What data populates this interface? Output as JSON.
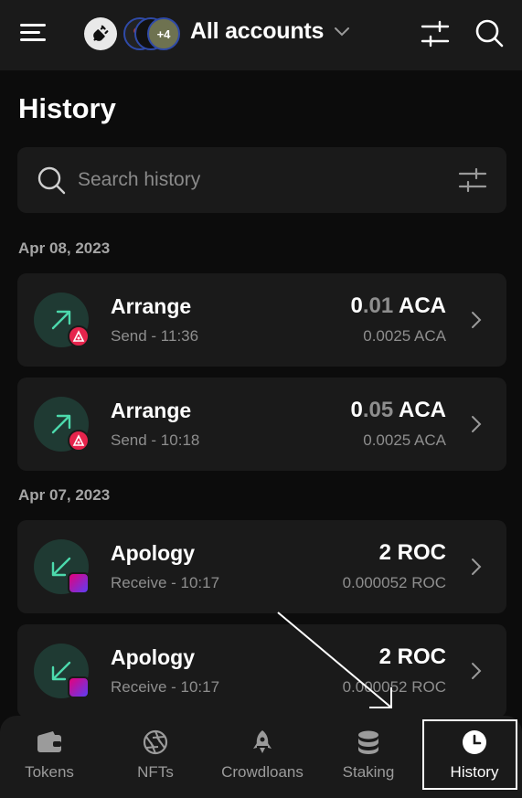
{
  "header": {
    "account_name": "All accounts",
    "avatar_extra_count": "+4",
    "icons": [
      "menu-icon",
      "plug-icon",
      "chevron-down-icon",
      "sliders-icon",
      "search-icon"
    ]
  },
  "page_title": "History",
  "search": {
    "placeholder": "Search history"
  },
  "groups": [
    {
      "date": "Apr 08, 2023",
      "items": [
        {
          "title": "Arrange",
          "subtitle": "Send - 11:36",
          "amount_int": "0",
          "amount_dec": ".01",
          "amount_unit": " ACA",
          "fee": "0.0025 ACA",
          "direction": "send",
          "token": "ACA"
        },
        {
          "title": "Arrange",
          "subtitle": "Send - 10:18",
          "amount_int": "0",
          "amount_dec": ".05",
          "amount_unit": " ACA",
          "fee": "0.0025 ACA",
          "direction": "send",
          "token": "ACA"
        }
      ]
    },
    {
      "date": "Apr 07, 2023",
      "items": [
        {
          "title": "Apology",
          "subtitle": "Receive - 10:17",
          "amount_int": "2",
          "amount_dec": "",
          "amount_unit": " ROC",
          "fee": "0.000052 ROC",
          "direction": "receive",
          "token": "ROC"
        },
        {
          "title": "Apology",
          "subtitle": "Receive - 10:17",
          "amount_int": "2",
          "amount_dec": "",
          "amount_unit": " ROC",
          "fee": "0.000052 ROC",
          "direction": "receive",
          "token": "ROC"
        }
      ]
    }
  ],
  "nav": [
    {
      "label": "Tokens",
      "icon": "wallet-icon"
    },
    {
      "label": "NFTs",
      "icon": "aperture-icon"
    },
    {
      "label": "Crowdloans",
      "icon": "rocket-icon"
    },
    {
      "label": "Staking",
      "icon": "database-icon"
    },
    {
      "label": "History",
      "icon": "clock-icon",
      "active": true
    }
  ],
  "colors": {
    "background": "#0c0c0c",
    "card": "#1a1a1a",
    "send_icon_bg": "#1f3a33",
    "arrow_green": "#4cd9ac",
    "aca_red": "#e6244c"
  }
}
